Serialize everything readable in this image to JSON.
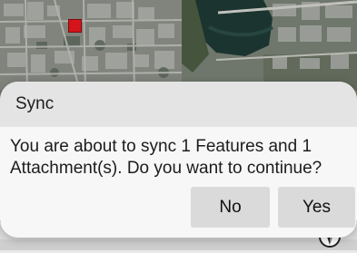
{
  "map": {
    "marker_color": "#d4151b"
  },
  "dialog": {
    "title": "Sync",
    "message": "You are about to sync 1 Features and 1 Attachment(s). Do you want to continue?",
    "buttons": {
      "no": "No",
      "yes": "Yes"
    }
  },
  "icons": {
    "compass": "compass-icon"
  }
}
